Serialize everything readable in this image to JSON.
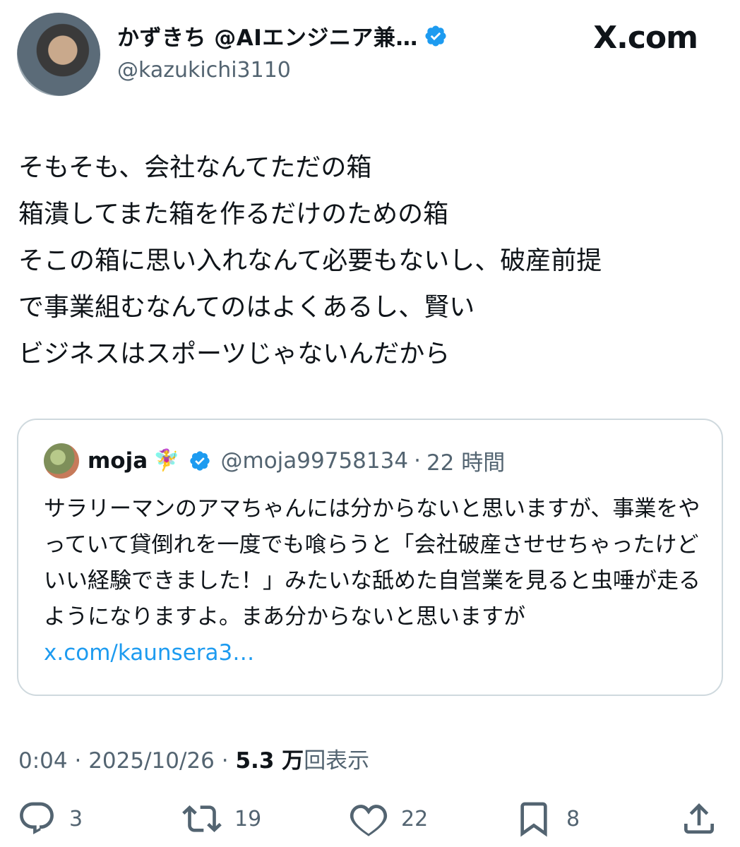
{
  "author": {
    "name": "かずきち @AIエンジニア兼…",
    "handle": "@kazukichi3110"
  },
  "brand": "X.com",
  "tweet": {
    "text": "そもそも、会社なんてただの箱\n箱潰してまた箱を作るだけのための箱\nそこの箱に思い入れなんて必要もないし、破産前提\nで事業組むなんてのはよくあるし、賢い\nビジネスはスポーツじゃないんだから"
  },
  "quote": {
    "name": "moja",
    "emoji": "🧚‍♀️",
    "handle": "@moja99758134",
    "separator": "·",
    "time": "22 時間",
    "text": "サラリーマンのアマちゃんには分からないと思いますが、事業をやっていて貸倒れを一度でも喰らうと「会社破産させせちゃったけどいい経験できました！」みたいな舐めた自営業を見ると虫唾が走るようになりますよ。まあ分からないと思いますが ",
    "link": "x.com/kaunsera3…"
  },
  "meta": {
    "time": "0:04",
    "sep1": "·",
    "date": "2025/10/26",
    "sep2": "·",
    "views": "5.3 万",
    "views_label": "回表示"
  },
  "actions": {
    "replies": "3",
    "reposts": "19",
    "likes": "22",
    "bookmarks": "8"
  },
  "colors": {
    "verified": "#1d9bf0",
    "link": "#1d9bf0",
    "muted": "#536471"
  }
}
